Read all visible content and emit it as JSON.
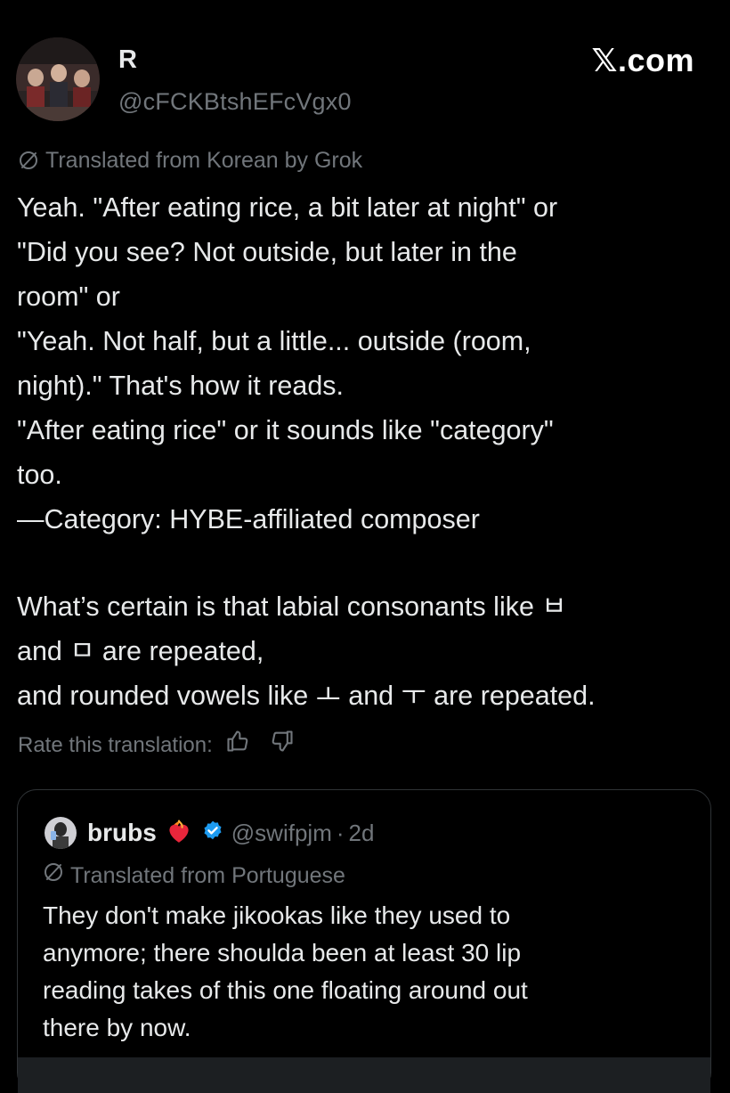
{
  "post": {
    "author": {
      "display_name": "R",
      "handle": "@cFCKBtshEFcVgx0"
    },
    "site_logo": "𝕏.com",
    "translation_note": "Translated from Korean by Grok",
    "body_lines": [
      "Yeah. \"After eating rice, a bit later at night\" or",
      "\"Did you see? Not outside, but later in the",
      "room\" or",
      "\"Yeah. Not half, but a little... outside (room,",
      "night).\" That's how it reads.",
      "\"After eating rice\" or it sounds like \"category\"",
      "too.",
      "—Category: HYBE-affiliated composer",
      "",
      "What’s certain is that labial consonants like ㅂ",
      "and ㅁ are repeated,",
      "and rounded vowels like ㅗ and ㅜ are repeated."
    ],
    "rate_label": "Rate this translation:"
  },
  "quote": {
    "display_name": "brubs",
    "handle": "@swifpjm",
    "separator": "·",
    "time": "2d",
    "translation_note": "Translated from Portuguese",
    "body_lines": [
      "They don't make jikookas like they used to",
      "anymore; there shoulda been at least 30 lip",
      "reading takes of this one floating around out",
      "there by now."
    ]
  },
  "icons": {
    "translate": "translate-slash-icon",
    "thumbs_up": "thumbs-up-icon",
    "thumbs_down": "thumbs-down-icon",
    "verified": "verified-badge-icon",
    "heart": "flaming-heart-icon"
  },
  "colors": {
    "background": "#000000",
    "text_primary": "#e7e9ea",
    "text_secondary": "#71767b",
    "verified_blue": "#1d9bf0",
    "border": "#2f3336"
  }
}
